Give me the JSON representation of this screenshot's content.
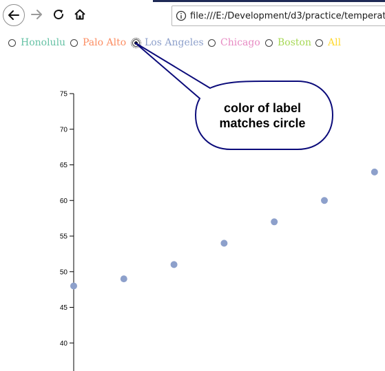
{
  "browser": {
    "url": "file:///E:/Development/d3/practice/temperatur",
    "icons": [
      "back-arrow",
      "forward-arrow",
      "reload",
      "home",
      "info"
    ]
  },
  "radios": [
    {
      "label": "Honolulu",
      "color": "#66c2a5",
      "checked": false
    },
    {
      "label": "Palo Alto",
      "color": "#fc8d62",
      "checked": false
    },
    {
      "label": "Los Angeles",
      "color": "#8da0cb",
      "checked": true
    },
    {
      "label": "Chicago",
      "color": "#e78ac3",
      "checked": false
    },
    {
      "label": "Boston",
      "color": "#a6d854",
      "checked": false
    },
    {
      "label": "All",
      "color": "#ffd92f",
      "checked": false
    }
  ],
  "callout": {
    "text_line1": "color of label",
    "text_line2": "matches circle",
    "border_color": "#0b0b7a"
  },
  "chart_data": {
    "type": "scatter",
    "title": "",
    "xlabel": "",
    "ylabel": "",
    "ylim": [
      35,
      75
    ],
    "yticks": [
      40,
      45,
      50,
      55,
      60,
      65,
      70,
      75
    ],
    "series": [
      {
        "color": "#8da0cb",
        "x": [
          0,
          1,
          2,
          3,
          4,
          5,
          6
        ],
        "y": [
          48,
          49,
          51,
          54,
          57,
          60,
          64
        ]
      }
    ]
  }
}
